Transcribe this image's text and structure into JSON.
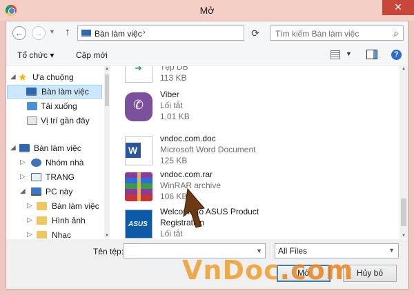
{
  "window": {
    "title": "Mở",
    "close_glyph": "✕"
  },
  "nav": {
    "address_segment": "Bàn làm việc",
    "search_placeholder": "Tìm kiếm Bàn làm việc"
  },
  "toolbar": {
    "organize": "Tổ chức",
    "new_folder": "Cập mới"
  },
  "tree": [
    {
      "label": "Ưa chuộng",
      "icon": "star-icon"
    },
    {
      "label": "Bàn làm việc",
      "icon": "desktop-icon",
      "selected": true
    },
    {
      "label": "Tải xuống",
      "icon": "download-folder-icon"
    },
    {
      "label": "Vị trí gần đây",
      "icon": "recent-places-icon"
    },
    {
      "label": "Bàn làm việc",
      "icon": "desktop-icon"
    },
    {
      "label": "Nhóm nhà",
      "icon": "homegroup-icon"
    },
    {
      "label": "TRANG",
      "icon": "user-folder-icon"
    },
    {
      "label": "PC này",
      "icon": "computer-icon"
    },
    {
      "label": "Bàn làm việc",
      "icon": "folder-icon"
    },
    {
      "label": "Hình ảnh",
      "icon": "folder-icon"
    },
    {
      "label": "Nhạc",
      "icon": "folder-icon"
    }
  ],
  "files": [
    {
      "name": "",
      "type": "Tệp DB",
      "size": "113 KB",
      "icon": "db-file-icon"
    },
    {
      "name": "Viber",
      "type": "Lối tắt",
      "size": "1,01 KB",
      "icon": "viber-icon"
    },
    {
      "name": "vndoc.com.doc",
      "type": "Microsoft Word Document",
      "size": "125 KB",
      "icon": "word-icon"
    },
    {
      "name": "vndoc.com.rar",
      "type": "WinRAR archive",
      "size": "106 KB",
      "icon": "winrar-icon"
    },
    {
      "name": "Welcome to ASUS Product",
      "type": "Registration",
      "size": "Lối tắt",
      "icon": "asus-icon"
    }
  ],
  "bottom": {
    "filename_label": "Tên tệp:",
    "filename_value": "",
    "filter": "All Files",
    "open_button": "Mở",
    "cancel_button": "Hủy bỏ"
  },
  "watermark": {
    "text": "VnDoc",
    "suffix": ".com"
  },
  "colors": {
    "selection": "#cce8ff",
    "title_bar": "#f3cfc6",
    "close": "#c7473a"
  }
}
